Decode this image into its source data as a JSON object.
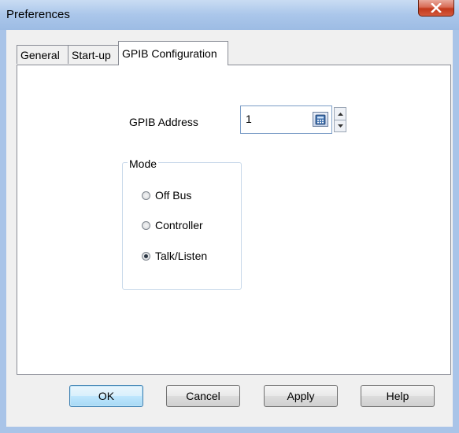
{
  "window": {
    "title": "Preferences",
    "close_label": "X"
  },
  "tabs": [
    {
      "label": "General",
      "active": false
    },
    {
      "label": "Start-up",
      "active": false
    },
    {
      "label": "GPIB Configuration",
      "active": true
    }
  ],
  "gpib": {
    "address_label": "GPIB Address",
    "address_value": "1",
    "mode_label": "Mode",
    "modes": [
      {
        "label": "Off Bus",
        "checked": false
      },
      {
        "label": "Controller",
        "checked": false
      },
      {
        "label": "Talk/Listen",
        "checked": true
      }
    ]
  },
  "buttons": {
    "ok": "OK",
    "cancel": "Cancel",
    "apply": "Apply",
    "help": "Help"
  },
  "colors": {
    "frame": "#a9c4e8",
    "close": "#c2391c",
    "default_button_border": "#3c7fb1"
  },
  "icons": {
    "calculator": "calculator-icon",
    "spin_up": "chevron-up-icon",
    "spin_down": "chevron-down-icon"
  }
}
